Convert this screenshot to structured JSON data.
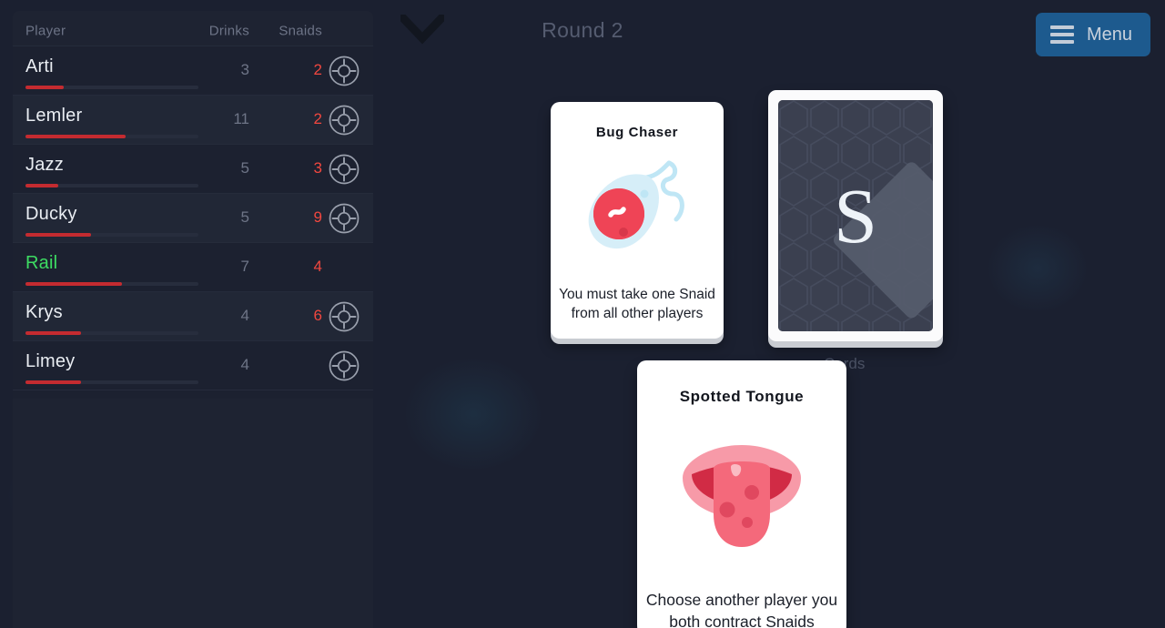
{
  "header": {
    "collapse_icon": "chevron-down-icon",
    "round_label": "Round 2",
    "menu_label": "Menu",
    "menu_icon": "hamburger-icon",
    "menu_color": "#1d5a8e"
  },
  "scoreboard": {
    "columns": {
      "player": "Player",
      "drinks": "Drinks",
      "snaids": "Snaids"
    },
    "target_icon": "crosshair-target-icon",
    "snaids_color": "#f2473f",
    "self_color": "#3ddc62",
    "bar_color": "#c42b30",
    "rows": [
      {
        "name": "Arti",
        "drinks": "3",
        "snaids": "2",
        "bar_pct": 22,
        "is_self": false,
        "has_target": true
      },
      {
        "name": "Lemler",
        "drinks": "11",
        "snaids": "2",
        "bar_pct": 58,
        "is_self": false,
        "has_target": true
      },
      {
        "name": "Jazz",
        "drinks": "5",
        "snaids": "3",
        "bar_pct": 19,
        "is_self": false,
        "has_target": true
      },
      {
        "name": "Ducky",
        "drinks": "5",
        "snaids": "9",
        "bar_pct": 38,
        "is_self": false,
        "has_target": true
      },
      {
        "name": "Rail",
        "drinks": "7",
        "snaids": "4",
        "bar_pct": 56,
        "is_self": true,
        "has_target": false
      },
      {
        "name": "Krys",
        "drinks": "4",
        "snaids": "6",
        "bar_pct": 32,
        "is_self": false,
        "has_target": true
      },
      {
        "name": "Limey",
        "drinks": "4",
        "snaids": "",
        "bar_pct": 32,
        "is_self": false,
        "has_target": true
      }
    ]
  },
  "deck": {
    "label": "Cards",
    "logo_letter": "S",
    "back_icon": "hexagon-pattern-card-back"
  },
  "cards": [
    {
      "id": "bug-chaser",
      "title": "Bug Chaser",
      "description": "You must take one Snaid from all other players",
      "art_icon": "bug-droplet-icon"
    },
    {
      "id": "spotted-tongue",
      "title": "Spotted Tongue",
      "description": "Choose another player you both contract Snaids",
      "art_icon": "spotted-tongue-icon"
    }
  ]
}
